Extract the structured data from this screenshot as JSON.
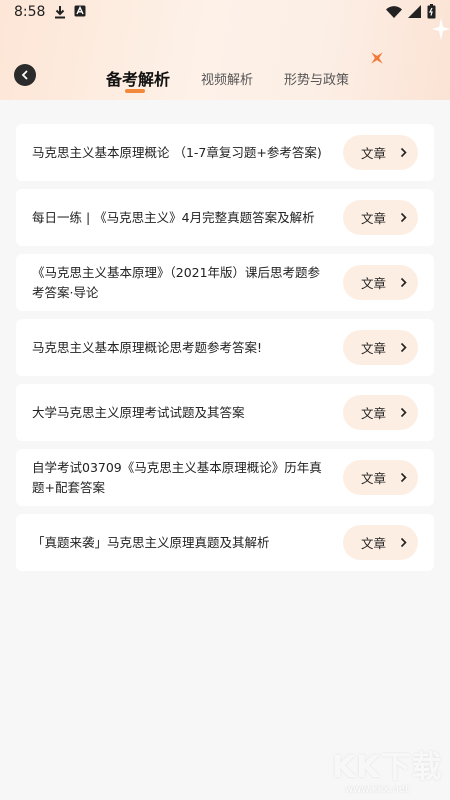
{
  "status_bar": {
    "time": "8:58",
    "left_icons": [
      "download-icon",
      "notification-a-icon"
    ],
    "right_icons": [
      "wifi-icon",
      "signal-icon",
      "battery-icon"
    ]
  },
  "header": {
    "back_icon": "back-icon",
    "tabs": [
      {
        "label": "备考解析",
        "active": true
      },
      {
        "label": "视频解析",
        "active": false
      },
      {
        "label": "形势与政策",
        "active": false
      }
    ],
    "accent_color": "#f08a3a"
  },
  "articles": [
    {
      "title": "马克思主义基本原理概论 （1-7章复习题+参考答案)",
      "button": "文章"
    },
    {
      "title": "每日一练 | 《马克思主义》4月完整真题答案及解析",
      "button": "文章"
    },
    {
      "title": "《马克思主义基本原理》（2021年版）课后思考题参考答案·导论",
      "button": "文章"
    },
    {
      "title": "马克思主义基本原理概论思考题参考答案!",
      "button": "文章"
    },
    {
      "title": "大学马克思主义原理考试试题及其答案",
      "button": "文章"
    },
    {
      "title": "自学考试03709《马克思主义基本原理概论》历年真题+配套答案",
      "button": "文章"
    },
    {
      "title": "「真题来袭」马克思主义原理真题及其解析",
      "button": "文章"
    }
  ],
  "watermark": {
    "text": "KK下载",
    "url": "www.kkx.net"
  }
}
